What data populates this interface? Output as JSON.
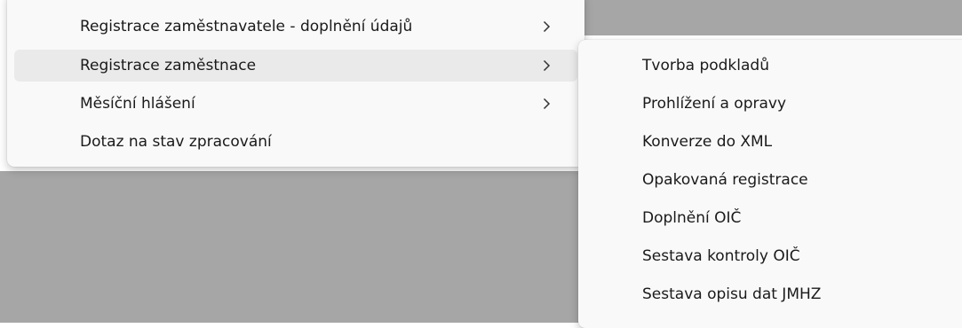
{
  "main_menu": {
    "items": [
      {
        "label": "Registrace zaměstnavatele - doplnění údajů",
        "has_submenu": true
      },
      {
        "label": "Registrace zaměstnace",
        "has_submenu": true,
        "highlighted": true
      },
      {
        "label": "Měsíční hlášení",
        "has_submenu": true
      },
      {
        "label": "Dotaz na stav zpracování",
        "has_submenu": false
      }
    ]
  },
  "submenu": {
    "items": [
      {
        "label": "Tvorba podkladů"
      },
      {
        "label": "Prohlížení a opravy"
      },
      {
        "label": "Konverze do XML"
      },
      {
        "label": "Opakovaná registrace"
      },
      {
        "label": "Doplnění OIČ"
      },
      {
        "label": "Sestava kontroly OIČ"
      },
      {
        "label": "Sestava opisu dat JMHZ"
      }
    ]
  },
  "icons": {
    "submenu_indicator": "chevron-right-icon"
  },
  "colors": {
    "menu_background": "#f9f9f9",
    "highlight": "#eaeaea",
    "background_window": "#a6a6a6",
    "text": "#1a1a1a"
  }
}
